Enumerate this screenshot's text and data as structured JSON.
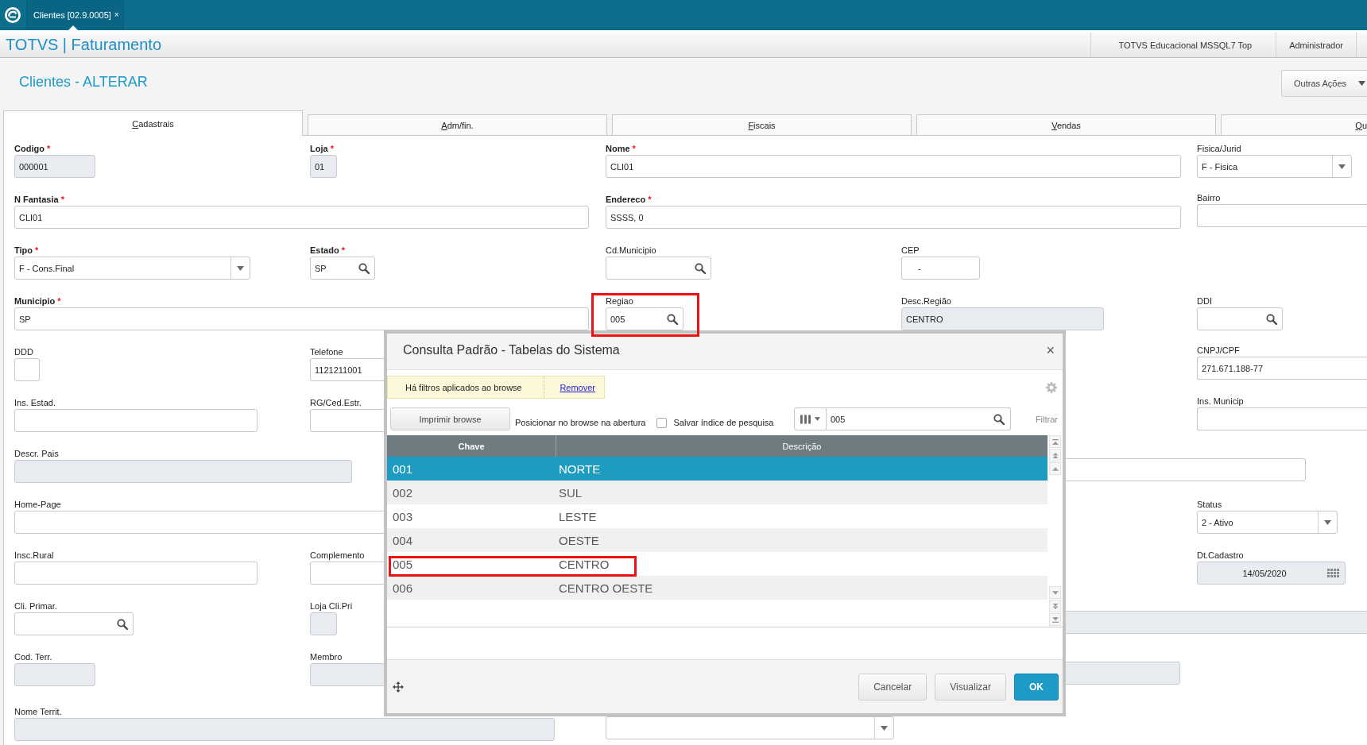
{
  "app_bar": {
    "tabs": [
      {
        "label": "Clientes [02.9.0005]",
        "close": "×",
        "selected": true
      }
    ]
  },
  "header": {
    "product": "TOTVS | Faturamento",
    "environment": "TOTVS Educacional MSSQL7 Top",
    "user": "Administrador"
  },
  "page": {
    "title": "Clientes - ALTERAR",
    "actions_button": "Outras Ações"
  },
  "tabs": [
    {
      "label": "Cadastrais",
      "selected": true
    },
    {
      "label": "Adm/fin.",
      "selected": false
    },
    {
      "label": "Fiscais",
      "selected": false
    },
    {
      "label": "Vendas",
      "selected": false
    },
    {
      "label": "Qu",
      "selected": false
    }
  ],
  "form": {
    "rows": [
      {
        "fields": [
          {
            "label": "Codigo",
            "mark": "*",
            "kind": "text",
            "value": "000001",
            "disabled": true,
            "highlighted": false
          },
          {
            "label": "Loja",
            "mark": "*",
            "kind": "text",
            "value": "01",
            "disabled": true,
            "highlighted": false
          },
          {
            "label": "Nome",
            "mark": "*",
            "kind": "text",
            "value": "CLI01",
            "disabled": false,
            "highlighted": false
          },
          {
            "label": "Fisica/Jurid",
            "kind": "select",
            "value": "F - Fisica",
            "disabled": false,
            "highlighted": false
          }
        ]
      },
      {
        "fields": [
          {
            "label": "N Fantasia",
            "mark": "*",
            "kind": "text",
            "value": "CLI01",
            "disabled": false,
            "highlighted": false
          },
          {
            "label": "Endereco",
            "mark": "*",
            "kind": "text",
            "value": "SSSS, 0",
            "disabled": false,
            "highlighted": false
          },
          {
            "label": "Bairro",
            "kind": "text",
            "disabled": false,
            "highlighted": false
          }
        ]
      },
      {
        "fields": [
          {
            "label": "Tipo",
            "mark": "*",
            "kind": "select",
            "value": "F - Cons.Final",
            "disabled": false,
            "highlighted": false
          },
          {
            "label": "Estado",
            "mark": "*",
            "kind": "lookup",
            "value": "SP",
            "disabled": false,
            "highlighted": false
          },
          {
            "label": "Cd.Municipio",
            "kind": "lookup",
            "disabled": false,
            "highlighted": false
          },
          {
            "label": "CEP",
            "kind": "text",
            "value": "-",
            "disabled": false,
            "highlighted": false
          }
        ]
      },
      {
        "fields": [
          {
            "label": "Municipio",
            "mark": "*",
            "kind": "text",
            "value": "SP",
            "disabled": false,
            "highlighted": false
          },
          {
            "label": "Regiao",
            "kind": "lookup",
            "value": "005",
            "disabled": false,
            "highlighted": true
          },
          {
            "label": "Desc.Região",
            "kind": "text",
            "value": "CENTRO",
            "disabled": true,
            "highlighted": false
          },
          {
            "label": "DDI",
            "kind": "lookup",
            "disabled": false,
            "highlighted": false
          }
        ]
      },
      {
        "fields": [
          {
            "label": "DDD",
            "kind": "text",
            "disabled": false,
            "highlighted": false
          },
          {
            "label": "Telefone",
            "kind": "text",
            "value": "1121211001",
            "disabled": false,
            "highlighted": false
          },
          {
            "label": "CNPJ/CPF",
            "kind": "text",
            "value": "271.671.188-77",
            "disabled": false,
            "highlighted": false
          }
        ]
      },
      {
        "fields": [
          {
            "label": "Ins. Estad.",
            "kind": "text",
            "disabled": false,
            "highlighted": false
          },
          {
            "label": "RG/Ced.Estr.",
            "kind": "text",
            "disabled": false,
            "highlighted": false
          },
          {
            "label": "Ins. Municip",
            "kind": "text",
            "disabled": false,
            "highlighted": false
          }
        ]
      },
      {
        "fields": [
          {
            "label": "Descr. Pais",
            "kind": "text",
            "disabled": true,
            "highlighted": false
          },
          {
            "kind": "text",
            "disabled": false,
            "highlighted": false
          }
        ]
      },
      {
        "fields": [
          {
            "label": "Home-Page",
            "kind": "text",
            "disabled": false,
            "highlighted": false
          },
          {
            "label": "Status",
            "kind": "select",
            "value": "2 - Ativo",
            "disabled": false,
            "highlighted": false
          }
        ]
      },
      {
        "fields": [
          {
            "label": "Insc.Rural",
            "kind": "text",
            "disabled": false,
            "highlighted": false
          },
          {
            "label": "Complemento",
            "kind": "text",
            "disabled": false,
            "highlighted": false
          },
          {
            "label": "Dt.Cadastro",
            "kind": "date",
            "value": "14/05/2020",
            "disabled": true,
            "highlighted": false
          }
        ]
      },
      {
        "fields": [
          {
            "label": "Cli. Primar.",
            "kind": "lookup",
            "disabled": false,
            "highlighted": false
          },
          {
            "label": "Loja Cli.Pri",
            "kind": "text",
            "disabled": true,
            "highlighted": false
          },
          {
            "kind": "text",
            "disabled": true,
            "highlighted": false
          }
        ]
      },
      {
        "fields": [
          {
            "label": "Cod. Terr.",
            "kind": "text",
            "disabled": true,
            "highlighted": false
          },
          {
            "label": "Membro",
            "kind": "text",
            "disabled": true,
            "highlighted": false
          },
          {
            "kind": "text",
            "disabled": true,
            "highlighted": false
          }
        ]
      },
      {
        "fields": [
          {
            "label": "Nome Territ.",
            "kind": "text",
            "disabled": true,
            "highlighted": false
          },
          {
            "kind": "select",
            "disabled": false,
            "highlighted": false
          }
        ]
      }
    ]
  },
  "dialog": {
    "title": "Consulta Padrão - Tabelas do Sistema",
    "close": "×",
    "filter_notice": {
      "text": "Há filtros aplicados ao browse",
      "link": "Remover"
    },
    "print_button": "Imprimir browse",
    "position_option": "Posicionar no browse na abertura",
    "save_index": {
      "label": "Salvar índice de pesquisa",
      "checked": false
    },
    "search": {
      "value": "005"
    },
    "filter_button": "Filtrar",
    "table": {
      "columns": [
        {
          "label": "Chave",
          "sorted": true
        },
        {
          "label": "Descrição",
          "sorted": false
        }
      ],
      "rows": [
        {
          "cells": [
            "001",
            "NORTE"
          ],
          "selected": true,
          "highlighted": false
        },
        {
          "cells": [
            "002",
            "SUL"
          ],
          "selected": false,
          "highlighted": false
        },
        {
          "cells": [
            "003",
            "LESTE"
          ],
          "selected": false,
          "highlighted": false
        },
        {
          "cells": [
            "004",
            "OESTE"
          ],
          "selected": false,
          "highlighted": false
        },
        {
          "cells": [
            "005",
            "CENTRO"
          ],
          "selected": false,
          "highlighted": true
        },
        {
          "cells": [
            "006",
            "CENTRO OESTE"
          ],
          "selected": false,
          "highlighted": false
        }
      ]
    },
    "buttons": [
      {
        "label": "Cancelar",
        "kind": "default"
      },
      {
        "label": "Visualizar",
        "kind": "default"
      },
      {
        "label": "OK",
        "kind": "primary"
      }
    ]
  }
}
